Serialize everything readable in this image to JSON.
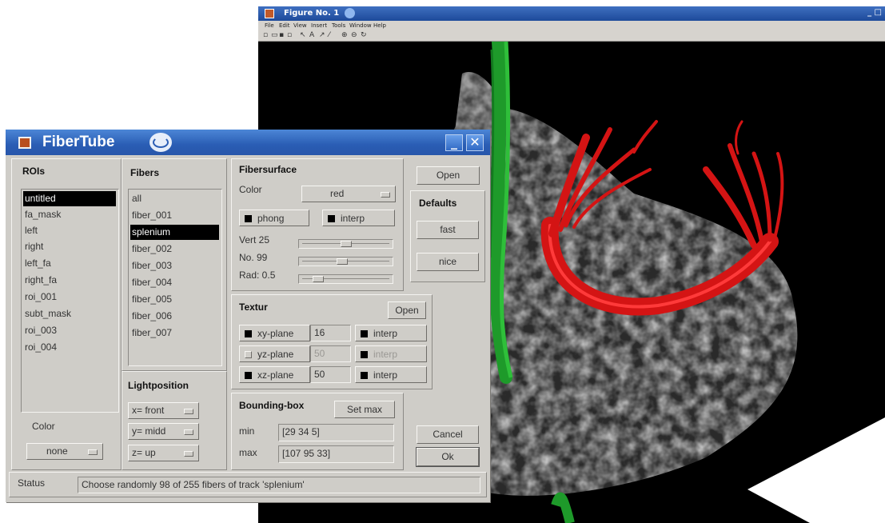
{
  "figure_window": {
    "title": "Figure No. 1",
    "window_buttons": "_ □",
    "menu": [
      "File",
      "Edit",
      "View",
      "Insert",
      "Tools",
      "Window",
      "Help"
    ],
    "toolbar_glyphs": [
      "▫",
      "▭",
      "▪",
      "▫",
      "↖",
      "A",
      "↗",
      "⁄",
      "⊕",
      "⊖",
      "↻"
    ]
  },
  "dialog": {
    "title": "FiberTube",
    "rois": {
      "label": "ROIs",
      "items": [
        "untitled",
        "fa_mask",
        "left",
        "right",
        "left_fa",
        "right_fa",
        "roi_001",
        "subt_mask",
        "roi_003",
        "roi_004"
      ],
      "selected": "untitled",
      "color_label": "Color",
      "color_value": "none"
    },
    "fibers": {
      "label": "Fibers",
      "items": [
        "all",
        "fiber_001",
        "splenium",
        "fiber_002",
        "fiber_003",
        "fiber_004",
        "fiber_005",
        "fiber_006",
        "fiber_007"
      ],
      "selected": "splenium"
    },
    "lightposition": {
      "label": "Lightposition",
      "x": "x= front",
      "y": "y= midd",
      "z": "z= up"
    },
    "fibersurface": {
      "label": "Fibersurface",
      "color_label": "Color",
      "color_value": "red",
      "phong": "phong",
      "interp": "interp",
      "vert": "Vert 25",
      "no": "No. 99",
      "rad": "Rad: 0.5",
      "vert_level": 0.5,
      "no_level": 0.45,
      "rad_level": 0.15
    },
    "textur": {
      "label": "Textur",
      "open": "Open",
      "xy_plane": "xy-plane",
      "xy_value": "16",
      "yz_plane": "yz-plane",
      "yz_value": "50",
      "xz_plane": "xz-plane",
      "xz_value": "50",
      "interp": "interp"
    },
    "bounding_box": {
      "label": "Bounding-box",
      "set_max": "Set max",
      "min_label": "min",
      "min_value": "[29  34   5]",
      "max_label": "max",
      "max_value": "[107  95  33]"
    },
    "buttons": {
      "open": "Open",
      "defaults_label": "Defaults",
      "fast": "fast",
      "nice": "nice",
      "cancel": "Cancel",
      "ok": "Ok"
    },
    "status": {
      "label": "Status",
      "text": "Choose randomly 98 of 255 fibers of track 'splenium'"
    }
  }
}
